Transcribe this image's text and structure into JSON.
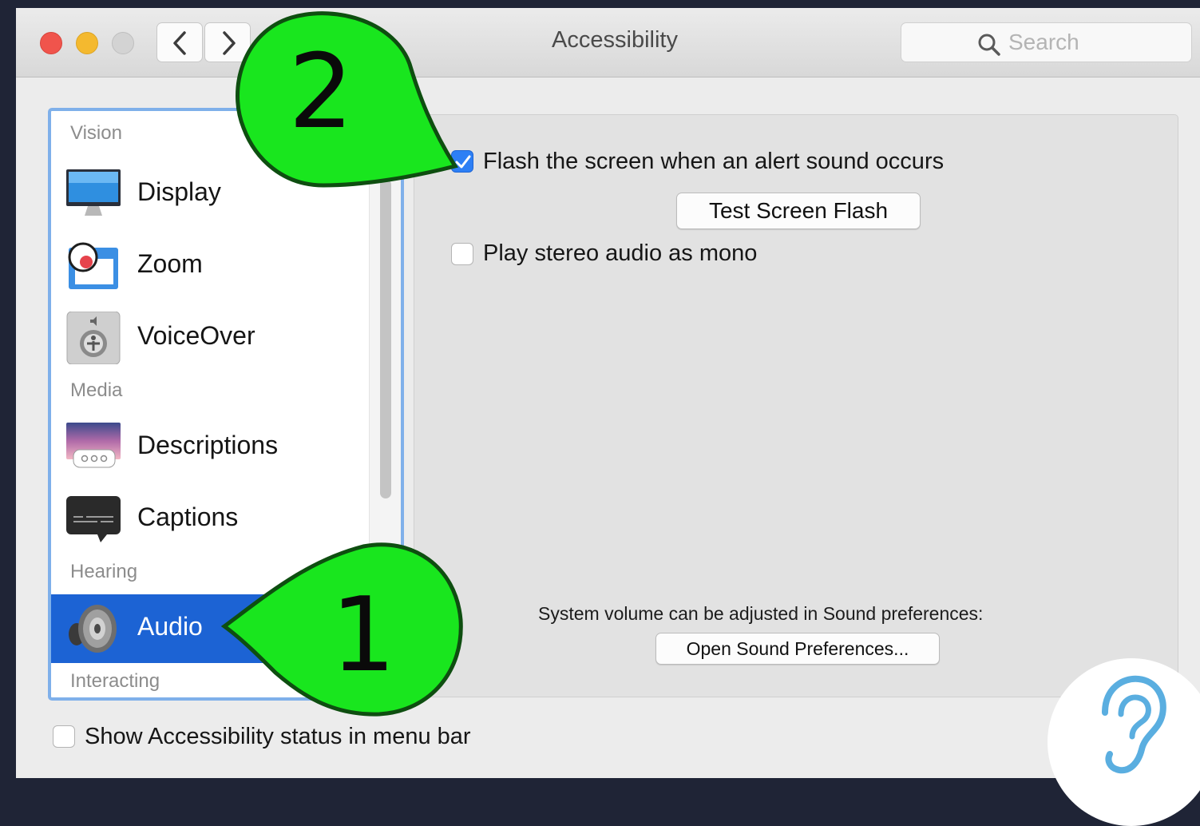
{
  "window": {
    "title": "Accessibility"
  },
  "search": {
    "placeholder": "Search"
  },
  "sidebar": {
    "sections": {
      "vision": "Vision",
      "media": "Media",
      "hearing": "Hearing",
      "interacting": "Interacting"
    },
    "items": [
      {
        "label": "Display",
        "icon": "display-icon"
      },
      {
        "label": "Zoom",
        "icon": "zoom-icon"
      },
      {
        "label": "VoiceOver",
        "icon": "voiceover-icon"
      },
      {
        "label": "Descriptions",
        "icon": "descriptions-icon"
      },
      {
        "label": "Captions",
        "icon": "captions-icon"
      },
      {
        "label": "Audio",
        "icon": "speaker-icon",
        "selected": true
      }
    ]
  },
  "audio_panel": {
    "flash_screen": {
      "label": "Flash the screen when an alert sound occurs",
      "checked": true
    },
    "test_flash_button": "Test Screen Flash",
    "stereo_mono": {
      "label": "Play stereo audio as mono",
      "checked": false
    },
    "volume_note": "System volume can be adjusted in Sound preferences:",
    "open_sound_button": "Open Sound Preferences..."
  },
  "footer": {
    "show_status": {
      "label": "Show Accessibility status in menu bar",
      "checked": false
    }
  },
  "annotations": {
    "callout_1": "1",
    "callout_2": "2",
    "callout_color": "#19e61e"
  },
  "colors": {
    "selection": "#1c63d4",
    "checkbox_checked": "#2d7ff5",
    "sidebar_focus_ring": "#7fb0ea"
  }
}
